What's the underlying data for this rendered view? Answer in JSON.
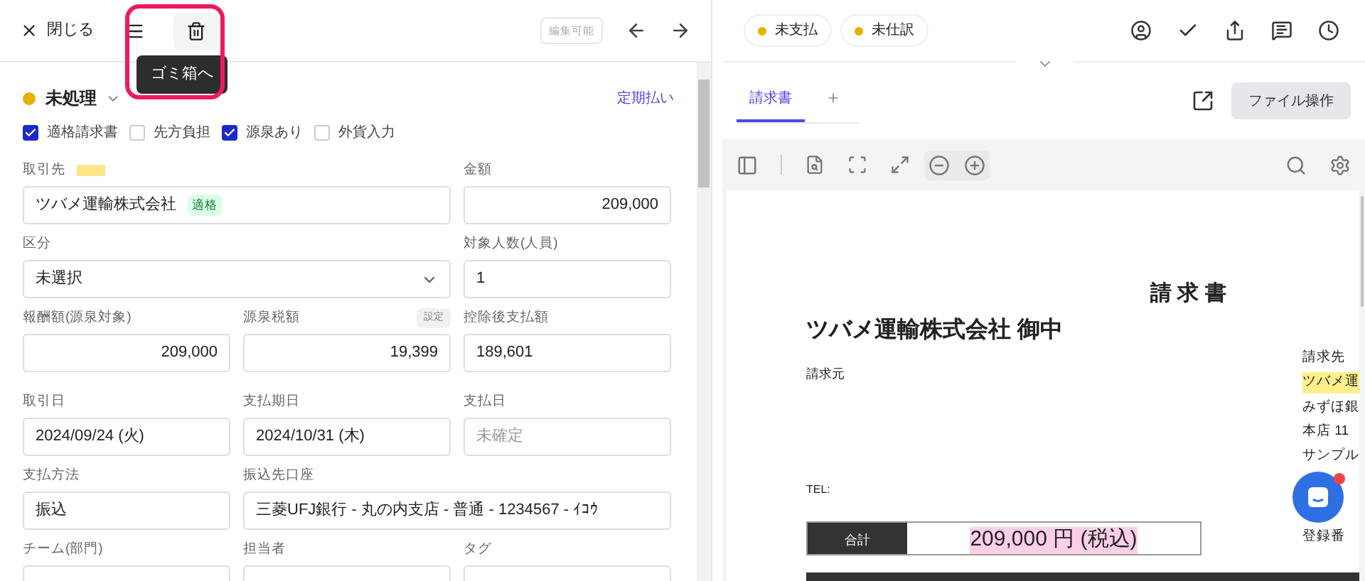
{
  "toolbar": {
    "close": "閉じる",
    "tooltip": "ゴミ箱へ",
    "edit_badge": "編集可能"
  },
  "status": {
    "label": "未処理",
    "color": "#e8b100"
  },
  "schedule_link": "定期払い",
  "checkboxes": [
    {
      "label": "適格請求書",
      "checked": true
    },
    {
      "label": "先方負担",
      "checked": false
    },
    {
      "label": "源泉あり",
      "checked": true
    },
    {
      "label": "外貨入力",
      "checked": false
    }
  ],
  "form_rows": [
    {
      "fields": [
        {
          "label": "取引先",
          "kind": "party",
          "value": "ツバメ運輸株式会社",
          "tag": "適格",
          "wide": true
        },
        {
          "label": "金額",
          "kind": "amount",
          "value": "209,000"
        }
      ]
    },
    {
      "fields": [
        {
          "label": "区分",
          "kind": "select",
          "value": "未選択",
          "wide": true
        },
        {
          "label": "対象人数(人員)",
          "kind": "text",
          "value": "1"
        }
      ]
    },
    {
      "fields": [
        {
          "label": "報酬額(源泉対象)",
          "kind": "amount",
          "value": "209,000"
        },
        {
          "label": "源泉税額",
          "kind": "amount",
          "value": "19,399",
          "badge": "設定"
        },
        {
          "label": "控除後支払額",
          "kind": "text",
          "value": "189,601"
        }
      ]
    },
    {
      "fields": [
        {
          "label": "取引日",
          "kind": "text",
          "value": "2024/09/24 (火)"
        },
        {
          "label": "支払期日",
          "kind": "text",
          "value": "2024/10/31 (木)"
        },
        {
          "label": "支払日",
          "kind": "text",
          "placeholder": "未確定"
        }
      ]
    },
    {
      "fields": [
        {
          "label": "支払方法",
          "kind": "text",
          "value": "振込"
        },
        {
          "label": "振込先口座",
          "kind": "text",
          "value": "三菱UFJ銀行 - 丸の内支店 - 普通 - 1234567 - ｲｺｳ",
          "wide": true
        }
      ]
    },
    {
      "fields": [
        {
          "label": "チーム(部門)",
          "kind": "text"
        },
        {
          "label": "担当者",
          "kind": "text"
        },
        {
          "label": "タグ",
          "kind": "text"
        }
      ]
    }
  ],
  "status_chips": [
    {
      "label": "未支払",
      "color": "#e8b100"
    },
    {
      "label": "未仕訳",
      "color": "#e8b100"
    }
  ],
  "tabs": [
    {
      "label": "請求書",
      "selected": true
    }
  ],
  "file_button": "ファイル操作",
  "document": {
    "title": "請 求 書",
    "recipient": "ツバメ運輸株式会社 御中",
    "issuer_label": "請求元",
    "tel": "TEL:",
    "total_label": "合計",
    "total": "209,000 円 (税込)",
    "bill_to": [
      {
        "text": "請求先",
        "highlighted": false
      },
      {
        "text": "ツバメ運",
        "highlighted": true
      },
      {
        "text": "みずほ銀",
        "highlighted": false
      },
      {
        "text": "本店 11",
        "highlighted": false
      },
      {
        "text": "サンプル",
        "highlighted": false
      },
      {
        "text": "登録番",
        "highlighted": false
      }
    ]
  }
}
